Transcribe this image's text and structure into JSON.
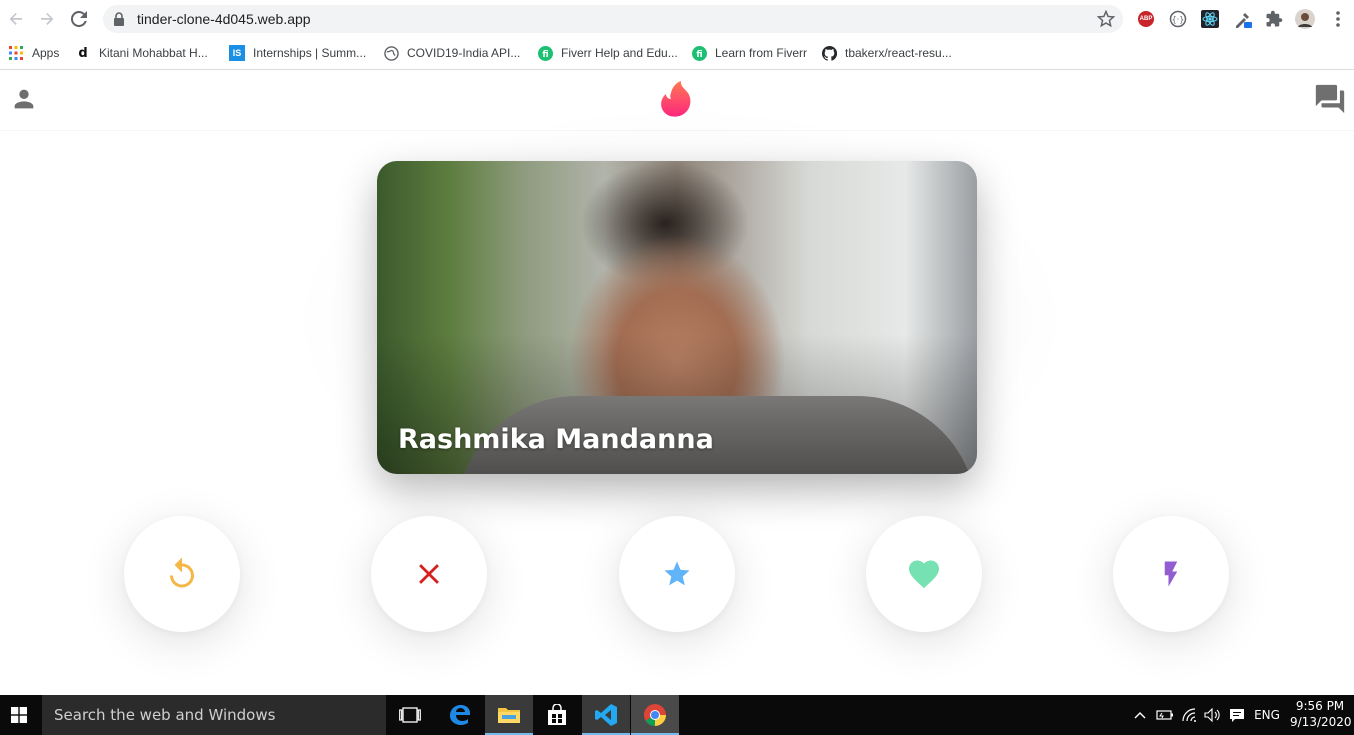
{
  "browser": {
    "url": "tinder-clone-4d045.web.app",
    "bookmarks": [
      {
        "label": "Apps",
        "icon": "apps-grid-icon"
      },
      {
        "label": "Kitani Mohabbat H...",
        "icon": "d-favicon"
      },
      {
        "label": "Internships | Summ...",
        "icon": "is-favicon"
      },
      {
        "label": "COVID19-India API...",
        "icon": "globe-favicon"
      },
      {
        "label": "Fiverr Help and Edu...",
        "icon": "fiverr-favicon"
      },
      {
        "label": "Learn from Fiverr",
        "icon": "fiverr-favicon"
      },
      {
        "label": "tbakerx/react-resu...",
        "icon": "github-favicon"
      }
    ],
    "extensions": {
      "abp_label": "ABP"
    }
  },
  "app": {
    "header": {
      "left_icon": "person-icon",
      "logo_icon": "tinder-flame-icon",
      "right_icon": "forum-chat-icon"
    },
    "card": {
      "name": "Rashmika Mandanna"
    },
    "buttons": [
      {
        "name": "undo-button",
        "icon": "replay-icon",
        "color": "#f5b748"
      },
      {
        "name": "dislike-button",
        "icon": "close-icon",
        "color": "#ec5e6f"
      },
      {
        "name": "super-like-button",
        "icon": "star-icon",
        "color": "#62b4f9"
      },
      {
        "name": "like-button",
        "icon": "heart-icon",
        "color": "#76e2b3"
      },
      {
        "name": "boost-button",
        "icon": "flash-icon",
        "color": "#915dd1"
      }
    ],
    "colors": {
      "brand": "#fd5068",
      "undo": "#f5b748",
      "dislike": "#d51f1f",
      "star": "#62b4f9",
      "heart": "#76e2b3",
      "flash": "#915dd1"
    }
  },
  "taskbar": {
    "search_placeholder": "Search the web and Windows",
    "language": "ENG",
    "time": "9:56 PM",
    "date": "9/13/2020"
  }
}
